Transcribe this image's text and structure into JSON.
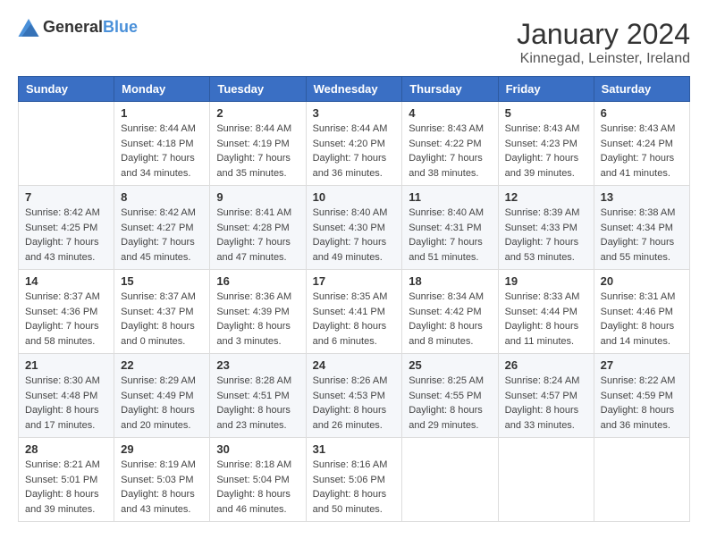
{
  "header": {
    "logo": {
      "general": "General",
      "blue": "Blue"
    },
    "title": "January 2024",
    "location": "Kinnegad, Leinster, Ireland"
  },
  "weekdays": [
    "Sunday",
    "Monday",
    "Tuesday",
    "Wednesday",
    "Thursday",
    "Friday",
    "Saturday"
  ],
  "weeks": [
    [
      {
        "day": "",
        "sunrise": "",
        "sunset": "",
        "daylight": ""
      },
      {
        "day": "1",
        "sunrise": "Sunrise: 8:44 AM",
        "sunset": "Sunset: 4:18 PM",
        "daylight": "Daylight: 7 hours and 34 minutes."
      },
      {
        "day": "2",
        "sunrise": "Sunrise: 8:44 AM",
        "sunset": "Sunset: 4:19 PM",
        "daylight": "Daylight: 7 hours and 35 minutes."
      },
      {
        "day": "3",
        "sunrise": "Sunrise: 8:44 AM",
        "sunset": "Sunset: 4:20 PM",
        "daylight": "Daylight: 7 hours and 36 minutes."
      },
      {
        "day": "4",
        "sunrise": "Sunrise: 8:43 AM",
        "sunset": "Sunset: 4:22 PM",
        "daylight": "Daylight: 7 hours and 38 minutes."
      },
      {
        "day": "5",
        "sunrise": "Sunrise: 8:43 AM",
        "sunset": "Sunset: 4:23 PM",
        "daylight": "Daylight: 7 hours and 39 minutes."
      },
      {
        "day": "6",
        "sunrise": "Sunrise: 8:43 AM",
        "sunset": "Sunset: 4:24 PM",
        "daylight": "Daylight: 7 hours and 41 minutes."
      }
    ],
    [
      {
        "day": "7",
        "sunrise": "Sunrise: 8:42 AM",
        "sunset": "Sunset: 4:25 PM",
        "daylight": "Daylight: 7 hours and 43 minutes."
      },
      {
        "day": "8",
        "sunrise": "Sunrise: 8:42 AM",
        "sunset": "Sunset: 4:27 PM",
        "daylight": "Daylight: 7 hours and 45 minutes."
      },
      {
        "day": "9",
        "sunrise": "Sunrise: 8:41 AM",
        "sunset": "Sunset: 4:28 PM",
        "daylight": "Daylight: 7 hours and 47 minutes."
      },
      {
        "day": "10",
        "sunrise": "Sunrise: 8:40 AM",
        "sunset": "Sunset: 4:30 PM",
        "daylight": "Daylight: 7 hours and 49 minutes."
      },
      {
        "day": "11",
        "sunrise": "Sunrise: 8:40 AM",
        "sunset": "Sunset: 4:31 PM",
        "daylight": "Daylight: 7 hours and 51 minutes."
      },
      {
        "day": "12",
        "sunrise": "Sunrise: 8:39 AM",
        "sunset": "Sunset: 4:33 PM",
        "daylight": "Daylight: 7 hours and 53 minutes."
      },
      {
        "day": "13",
        "sunrise": "Sunrise: 8:38 AM",
        "sunset": "Sunset: 4:34 PM",
        "daylight": "Daylight: 7 hours and 55 minutes."
      }
    ],
    [
      {
        "day": "14",
        "sunrise": "Sunrise: 8:37 AM",
        "sunset": "Sunset: 4:36 PM",
        "daylight": "Daylight: 7 hours and 58 minutes."
      },
      {
        "day": "15",
        "sunrise": "Sunrise: 8:37 AM",
        "sunset": "Sunset: 4:37 PM",
        "daylight": "Daylight: 8 hours and 0 minutes."
      },
      {
        "day": "16",
        "sunrise": "Sunrise: 8:36 AM",
        "sunset": "Sunset: 4:39 PM",
        "daylight": "Daylight: 8 hours and 3 minutes."
      },
      {
        "day": "17",
        "sunrise": "Sunrise: 8:35 AM",
        "sunset": "Sunset: 4:41 PM",
        "daylight": "Daylight: 8 hours and 6 minutes."
      },
      {
        "day": "18",
        "sunrise": "Sunrise: 8:34 AM",
        "sunset": "Sunset: 4:42 PM",
        "daylight": "Daylight: 8 hours and 8 minutes."
      },
      {
        "day": "19",
        "sunrise": "Sunrise: 8:33 AM",
        "sunset": "Sunset: 4:44 PM",
        "daylight": "Daylight: 8 hours and 11 minutes."
      },
      {
        "day": "20",
        "sunrise": "Sunrise: 8:31 AM",
        "sunset": "Sunset: 4:46 PM",
        "daylight": "Daylight: 8 hours and 14 minutes."
      }
    ],
    [
      {
        "day": "21",
        "sunrise": "Sunrise: 8:30 AM",
        "sunset": "Sunset: 4:48 PM",
        "daylight": "Daylight: 8 hours and 17 minutes."
      },
      {
        "day": "22",
        "sunrise": "Sunrise: 8:29 AM",
        "sunset": "Sunset: 4:49 PM",
        "daylight": "Daylight: 8 hours and 20 minutes."
      },
      {
        "day": "23",
        "sunrise": "Sunrise: 8:28 AM",
        "sunset": "Sunset: 4:51 PM",
        "daylight": "Daylight: 8 hours and 23 minutes."
      },
      {
        "day": "24",
        "sunrise": "Sunrise: 8:26 AM",
        "sunset": "Sunset: 4:53 PM",
        "daylight": "Daylight: 8 hours and 26 minutes."
      },
      {
        "day": "25",
        "sunrise": "Sunrise: 8:25 AM",
        "sunset": "Sunset: 4:55 PM",
        "daylight": "Daylight: 8 hours and 29 minutes."
      },
      {
        "day": "26",
        "sunrise": "Sunrise: 8:24 AM",
        "sunset": "Sunset: 4:57 PM",
        "daylight": "Daylight: 8 hours and 33 minutes."
      },
      {
        "day": "27",
        "sunrise": "Sunrise: 8:22 AM",
        "sunset": "Sunset: 4:59 PM",
        "daylight": "Daylight: 8 hours and 36 minutes."
      }
    ],
    [
      {
        "day": "28",
        "sunrise": "Sunrise: 8:21 AM",
        "sunset": "Sunset: 5:01 PM",
        "daylight": "Daylight: 8 hours and 39 minutes."
      },
      {
        "day": "29",
        "sunrise": "Sunrise: 8:19 AM",
        "sunset": "Sunset: 5:03 PM",
        "daylight": "Daylight: 8 hours and 43 minutes."
      },
      {
        "day": "30",
        "sunrise": "Sunrise: 8:18 AM",
        "sunset": "Sunset: 5:04 PM",
        "daylight": "Daylight: 8 hours and 46 minutes."
      },
      {
        "day": "31",
        "sunrise": "Sunrise: 8:16 AM",
        "sunset": "Sunset: 5:06 PM",
        "daylight": "Daylight: 8 hours and 50 minutes."
      },
      {
        "day": "",
        "sunrise": "",
        "sunset": "",
        "daylight": ""
      },
      {
        "day": "",
        "sunrise": "",
        "sunset": "",
        "daylight": ""
      },
      {
        "day": "",
        "sunrise": "",
        "sunset": "",
        "daylight": ""
      }
    ]
  ]
}
